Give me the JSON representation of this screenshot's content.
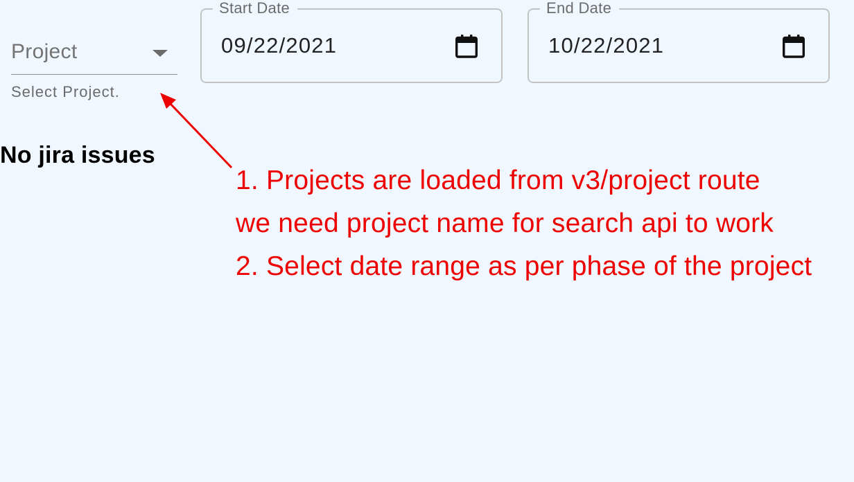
{
  "filters": {
    "project": {
      "label": "Project",
      "helper_text": "Select Project."
    },
    "start_date": {
      "label": "Start Date",
      "value": "09/22/2021"
    },
    "end_date": {
      "label": "End Date",
      "value": "10/22/2021"
    }
  },
  "results": {
    "empty_message": "No jira issues"
  },
  "annotation": {
    "color": "#ee0000",
    "lines": [
      "1. Projects are loaded from v3/project route",
      "we need project name for search api to work",
      "2. Select date range as per phase of the project"
    ]
  },
  "theme": {
    "background": "#f0f7ff",
    "border": "#c4c4c4",
    "muted_text": "#6b6b6b"
  },
  "icons": {
    "dropdown": "chevron-down-icon",
    "calendar": "calendar-icon"
  }
}
